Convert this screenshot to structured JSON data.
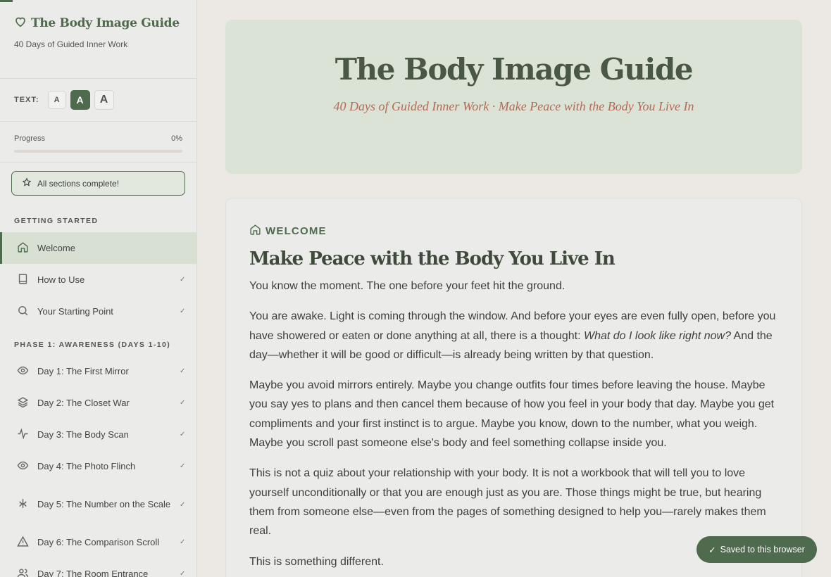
{
  "sidebar": {
    "brand_title": "The Body Image Guide",
    "brand_subtitle": "40 Days of Guided Inner Work",
    "text_size": {
      "label": "TEXT:",
      "small": "A",
      "medium": "A",
      "large": "A",
      "selected": "medium"
    },
    "progress": {
      "label": "Progress",
      "value_text": "0%",
      "fraction": 0
    },
    "complete_badge": "All sections complete!",
    "sections": [
      {
        "title": "GETTING STARTED",
        "items": [
          {
            "label": "Welcome",
            "icon": "home-icon",
            "active": true
          },
          {
            "label": "How to Use",
            "icon": "book-icon",
            "check": "✓"
          },
          {
            "label": "Your Starting Point",
            "icon": "search-icon",
            "check": "✓"
          }
        ]
      },
      {
        "title": "PHASE 1: AWARENESS (DAYS 1-10)",
        "items": [
          {
            "label": "Day 1: The First Mirror",
            "icon": "eye-icon",
            "check": "✓"
          },
          {
            "label": "Day 2: The Closet War",
            "icon": "layers-icon",
            "check": "✓"
          },
          {
            "label": "Day 3: The Body Scan",
            "icon": "pulse-icon",
            "check": "✓"
          },
          {
            "label": "Day 4: The Photo Flinch",
            "icon": "eye-icon",
            "check": "✓"
          },
          {
            "label": "Day 5: The Number on the Scale",
            "icon": "scale-icon",
            "check": "✓"
          },
          {
            "label": "Day 6: The Comparison Scroll",
            "icon": "warning-icon",
            "check": "✓"
          },
          {
            "label": "Day 7: The Room Entrance",
            "icon": "people-icon",
            "check": "✓"
          }
        ]
      }
    ]
  },
  "hero": {
    "title": "The Body Image Guide",
    "subtitle": "40 Days of Guided Inner Work · Make Peace with the Body You Live In"
  },
  "content": {
    "eyebrow": "WELCOME",
    "title": "Make Peace with the Body You Live In",
    "p1": "You know the moment. The one before your feet hit the ground.",
    "p2_before": "You are awake. Light is coming through the window. And before your eyes are even fully open, before you have showered or eaten or done anything at all, there is a thought: ",
    "p2_italic": "What do I look like right now?",
    "p2_after": " And the day—whether it will be good or difficult—is already being written by that question.",
    "p3": "Maybe you avoid mirrors entirely. Maybe you change outfits four times before leaving the house. Maybe you say yes to plans and then cancel them because of how you feel in your body that day. Maybe you get compliments and your first instinct is to argue. Maybe you know, down to the number, what you weigh. Maybe you scroll past someone else's body and feel something collapse inside you.",
    "p4": "This is not a quiz about your relationship with your body. It is not a workbook that will tell you to love yourself unconditionally or that you are enough just as you are. Those things might be true, but hearing them from someone else—even from the pages of something designed to help you—rarely makes them real.",
    "p5": "This is something different."
  },
  "toast": {
    "check": "✓",
    "label": "Saved to this browser"
  },
  "colors": {
    "accent": "#4e6b4d",
    "hero_bg": "#dbe2d6",
    "subtitle": "#b26b55",
    "page_bg": "#ece8e3"
  }
}
